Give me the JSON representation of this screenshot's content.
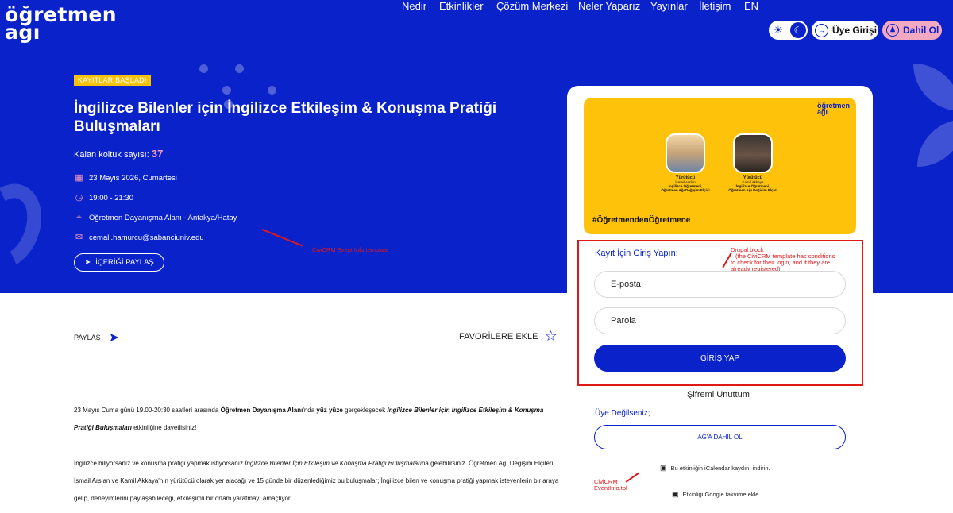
{
  "brand": {
    "logo_line1": "öğretmen",
    "logo_line2": "ağı"
  },
  "nav": {
    "items": [
      "Nedir",
      "Etkinlikler",
      "Çözüm Merkezi",
      "Neler Yaparız",
      "Yayınlar",
      "İletişim",
      "EN"
    ],
    "login_label": "Üye Girişi",
    "join_label": "Dahil Ol"
  },
  "event": {
    "badge": "KAYITLAR BAŞLADI",
    "title": "İngilizce Bilenler için İngilizce Etkileşim & Konuşma Pratiği Buluşmaları",
    "seats_label": "Kalan koltuk sayısı:",
    "seats_value": "37",
    "date": "23 Mayıs 2026, Cumartesi",
    "time": "19:00 - 21:30",
    "location": "Öğretmen Dayanışma Alanı - Antakya/Hatay",
    "email": "cemali.hamurcu@sabanciuniv.edu",
    "share_button": "İÇERİĞİ PAYLAŞ"
  },
  "annotations": {
    "event_info": "CiviCRM Event Info template",
    "drupal_block_1": "Drupal block",
    "drupal_block_2": "(the CiviCRM template has conditions",
    "drupal_block_3": "to check for their login, and if they are",
    "drupal_block_4": "already registered)",
    "tpl_1": "CiviCRM",
    "tpl_2": "EventInfo.tpl"
  },
  "actions": {
    "share_label": "PAYLAŞ",
    "favorite_label": "FAVORİLERE EKLE"
  },
  "description": {
    "p1_a": "23 Mayıs Cuma günü 19.00-20:30 saatleri arasında ",
    "p1_b": "Öğretmen Dayanışma Alanı",
    "p1_c": "'nda ",
    "p1_d": "yüz yüze",
    "p1_e": " gerçekleşecek ",
    "p1_f": "İngilizce Bilenler için İngilizce Etkileşim & Konuşma Pratiği Buluşmaları",
    "p1_g": " etkinliğine davetlisiniz!",
    "p2_a": "İngilizce biliyorsanız ve konuşma pratiği yapmak istiyorsanız ",
    "p2_b": "İngilizce Bilenler İçin Etkileşim ve Konuşma Pratiği Buluşmaları",
    "p2_c": "na gelebilirsiniz. Öğretmen Ağı Değişim Elçileri İsmail Arslan ve Kamil Akkaya'nın yürütücü olarak yer alacağı ve 15 günde bir düzenlediğimiz bu buluşmalar; İngilizce bilen ve konuşma pratiği yapmak isteyenlerin bir araya gelip, deneyimlerini paylaşabileceği, etkileşimli bir ortam yaratmayı amaçlıyor."
  },
  "poster": {
    "logo_line1": "öğretmen",
    "logo_line2": "ağı",
    "hashtag": "#ÖğretmendenÖğretmene",
    "people": [
      {
        "role": "Yürütücü",
        "name": "İsmail Arslan",
        "title1": "İngilizce Öğretmeni,",
        "title2": "Öğretmen Ağı Değişim Elçisi"
      },
      {
        "role": "Yürütücü",
        "name": "Kamil Akkaya",
        "title1": "İngilizce Öğretmeni,",
        "title2": "Öğretmen Ağı Değişim Elçisi"
      }
    ]
  },
  "login": {
    "title": "Kayıt İçin Giriş Yapın;",
    "email_placeholder": "E-posta",
    "password_placeholder": "Parola",
    "submit": "GİRİŞ YAP",
    "forgot": "Şifremi Unuttum",
    "not_member": "Üye Değilseniz;",
    "join": "AĞ'A DAHİL OL"
  },
  "calendar": {
    "ical": "Bu etkinliğin iCalendar kaydını indirin.",
    "google": "Etkinliği Google takvime ekle"
  },
  "colors": {
    "primary": "#0a22c9",
    "accent_pink": "#f49ac0",
    "badge_yellow": "#f7c20a",
    "annotation_red": "#e01818"
  },
  "icons": [
    "sun-icon",
    "moon-icon",
    "login-icon",
    "user-icon",
    "calendar-icon",
    "clock-icon",
    "location-icon",
    "mail-icon",
    "send-icon",
    "star-icon"
  ]
}
